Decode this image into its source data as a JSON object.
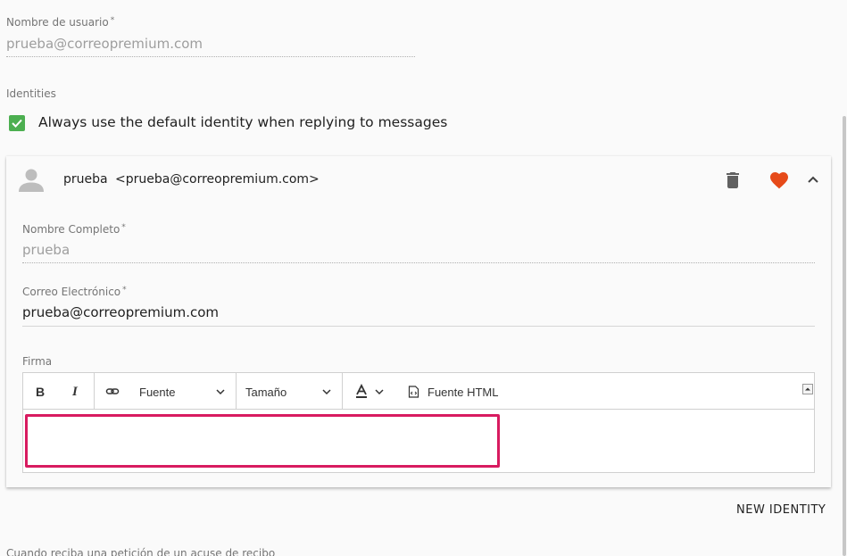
{
  "username": {
    "label": "Nombre de usuario",
    "required_mark": "*",
    "value": "prueba@correopremium.com"
  },
  "identities": {
    "section_label": "Identities",
    "checkbox_label": "Always use the default identity when replying to messages",
    "checkbox_checked": true,
    "card": {
      "name": "prueba",
      "email": "<prueba@correopremium.com>",
      "full_name_label": "Nombre Completo",
      "full_name_required": "*",
      "full_name_value": "prueba",
      "email_label": "Correo Electrónico",
      "email_required": "*",
      "email_value": "prueba@correopremium.com",
      "signature_label": "Firma",
      "toolbar": {
        "bold": "B",
        "italic": "I",
        "font_select": "Fuente",
        "size_select": "Tamaño",
        "source_button": "Fuente HTML"
      }
    },
    "new_identity_button": "NEW IDENTITY"
  },
  "cut_off_text": "Cuando reciba una petición de un acuse de recibo",
  "colors": {
    "checkbox": "#4caf50",
    "heart": "#e64a19",
    "signature_highlight": "#d81b60"
  }
}
